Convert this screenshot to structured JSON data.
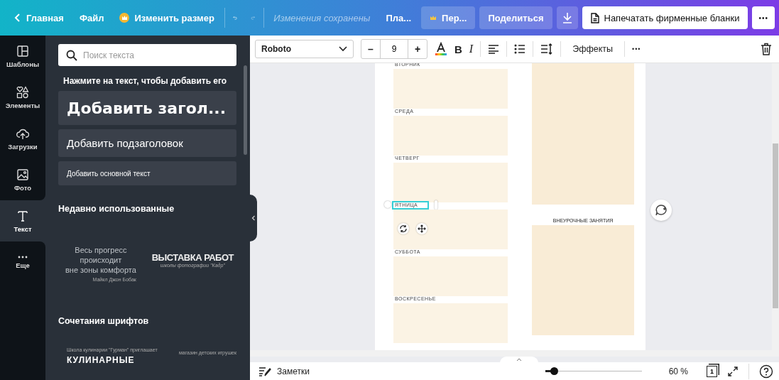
{
  "topbar": {
    "home": "Главная",
    "file": "Файл",
    "resize": "Изменить размер",
    "status": "Изменения сохранены",
    "plan": "Пла...",
    "premium": "Пер...",
    "share": "Поделиться",
    "print": "Напечатать фирменные бланки",
    "more": "•••"
  },
  "rail": [
    {
      "label": "Шаблоны",
      "selected": false
    },
    {
      "label": "Элементы",
      "selected": false
    },
    {
      "label": "Загрузки",
      "selected": false
    },
    {
      "label": "Фото",
      "selected": false
    },
    {
      "label": "Текст",
      "selected": true
    },
    {
      "label": "Еще",
      "selected": false
    }
  ],
  "panel": {
    "search": {
      "placeholder": "Поиск текста"
    },
    "hint": "Нажмите на текст, чтобы добавить его",
    "add": [
      {
        "kind": "heading",
        "label": "Добавить загол..."
      },
      {
        "kind": "subheading",
        "label": "Добавить подзаголовок"
      },
      {
        "kind": "body",
        "label": "Добавить основной текст"
      }
    ],
    "recent_title": "Недавно использованные",
    "recent": [
      {
        "kind": "quote",
        "lines": [
          "Весь прогресс",
          "происходит",
          "вне зоны комфорта"
        ],
        "caption": "Майкл Джон Бобак"
      },
      {
        "kind": "poster",
        "lines": [
          "ВЫСТАВКА РАБОТ"
        ],
        "caption": "школы фотографии \"Кадр\""
      }
    ],
    "combos_title": "Сочетания шрифтов",
    "combos": [
      {
        "caption": "Школа кулинарии \"Гурман\" приглашает",
        "lines": [
          "КУЛИНАРНЫЕ"
        ]
      },
      {
        "caption": "магазин детских игрушек"
      }
    ]
  },
  "toolbar": {
    "font": "Roboto",
    "minus": "–",
    "size": "9",
    "plus": "+",
    "bold": "B",
    "italic": "I",
    "effects": "Эффекты",
    "more": "•••"
  },
  "page": {
    "days": [
      {
        "label": "ВТОРНИК",
        "selected": false
      },
      {
        "label": "СРЕДА",
        "selected": false
      },
      {
        "label": "ЧЕТВЕРГ",
        "selected": false
      },
      {
        "label": "ЯТНИЦА",
        "selected": true
      },
      {
        "label": "СУББОТА",
        "selected": false
      },
      {
        "label": "ВОСКРЕСЕНЬЕ",
        "selected": false
      }
    ],
    "extra": "ВНЕУРОЧНЫЕ ЗАНЯТИЯ"
  },
  "bottom": {
    "notes": "Заметки",
    "zoom": {
      "level": 0.09
    },
    "zoom_reading": "60 %",
    "page_number": "1"
  }
}
